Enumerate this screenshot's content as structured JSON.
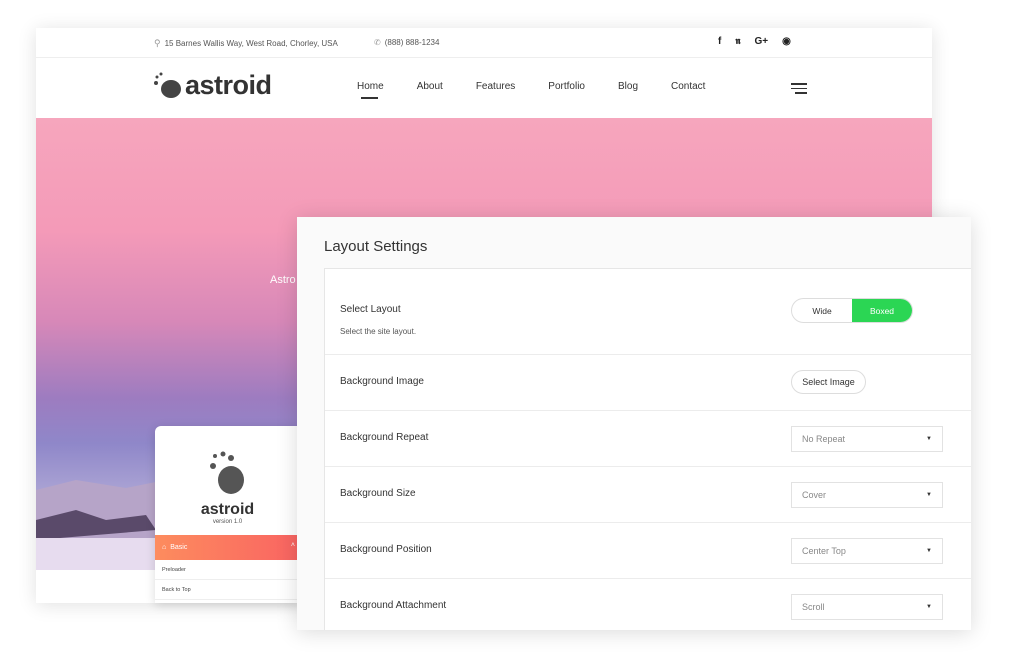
{
  "topbar": {
    "address": "15 Barnes Wallis Way, West Road, Chorley, USA",
    "phone": "(888) 888-1234",
    "social": [
      "f",
      "twitter",
      "G+",
      "github"
    ]
  },
  "logo": "astroid",
  "nav": {
    "items": [
      "Home",
      "About",
      "Features",
      "Portfolio",
      "Blog",
      "Contact"
    ],
    "active": "Home"
  },
  "hero": {
    "text": "Astro"
  },
  "sidebar_card": {
    "logo": "astroid",
    "version": "version 1.0",
    "section": "Basic",
    "items": [
      "Preloader",
      "Back to Top"
    ]
  },
  "panel": {
    "title": "Layout Settings",
    "select_layout": {
      "label": "Select Layout",
      "description": "Select the site layout.",
      "options": [
        "Wide",
        "Boxed"
      ],
      "selected": "Boxed"
    },
    "background_image": {
      "label": "Background Image",
      "button": "Select Image"
    },
    "background_repeat": {
      "label": "Background Repeat",
      "value": "No Repeat"
    },
    "background_size": {
      "label": "Background Size",
      "value": "Cover"
    },
    "background_position": {
      "label": "Background Position",
      "value": "Center Top"
    },
    "background_attachment": {
      "label": "Background Attachment",
      "value": "Scroll"
    }
  },
  "colors": {
    "accent": "#2bd654",
    "card_header": "#f96462"
  }
}
